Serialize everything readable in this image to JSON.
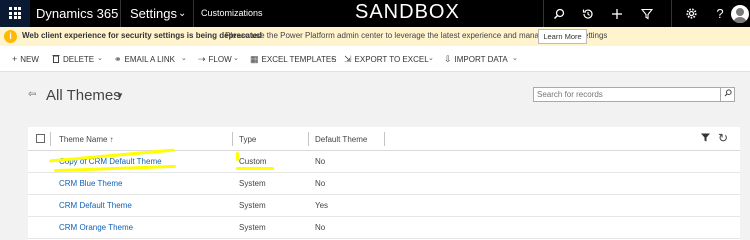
{
  "nav": {
    "app_name": "Dynamics 365",
    "area": "Settings",
    "area_chevron": "⌄",
    "sub_area": "Customizations",
    "environment": "SANDBOX",
    "icons": [
      "waffle-icon",
      "search-icon",
      "history-icon",
      "add-icon",
      "filter-icon",
      "gear-icon",
      "help-icon",
      "user-avatar"
    ]
  },
  "notice": {
    "icon": "i",
    "bold_text": "Web client experience for security settings is being deprecated",
    "text": "Please use the Power Platform admin center to leverage the latest experience and manage security settings",
    "button_label": "Learn More"
  },
  "commands": {
    "new": "NEW",
    "delete": "DELETE",
    "email_link": "EMAIL A LINK",
    "flow": "FLOW",
    "excel_templates": "EXCEL TEMPLATES",
    "export_excel": "EXPORT TO EXCEL",
    "import_data": "IMPORT DATA"
  },
  "view": {
    "title": "All Themes",
    "search_placeholder": "Search for records"
  },
  "grid": {
    "columns": [
      "Theme Name ↑",
      "Type",
      "Default Theme"
    ],
    "rows": [
      {
        "name": "Copy of CRM Default Theme",
        "type": "Custom",
        "default": "No"
      },
      {
        "name": "CRM Blue Theme",
        "type": "System",
        "default": "No"
      },
      {
        "name": "CRM Default Theme",
        "type": "System",
        "default": "Yes"
      },
      {
        "name": "CRM Orange Theme",
        "type": "System",
        "default": "No"
      }
    ]
  },
  "colors": {
    "topbar": "#000000",
    "notice_bg": "#fff4ce",
    "link": "#1160b7",
    "highlight": "#ffff00"
  }
}
